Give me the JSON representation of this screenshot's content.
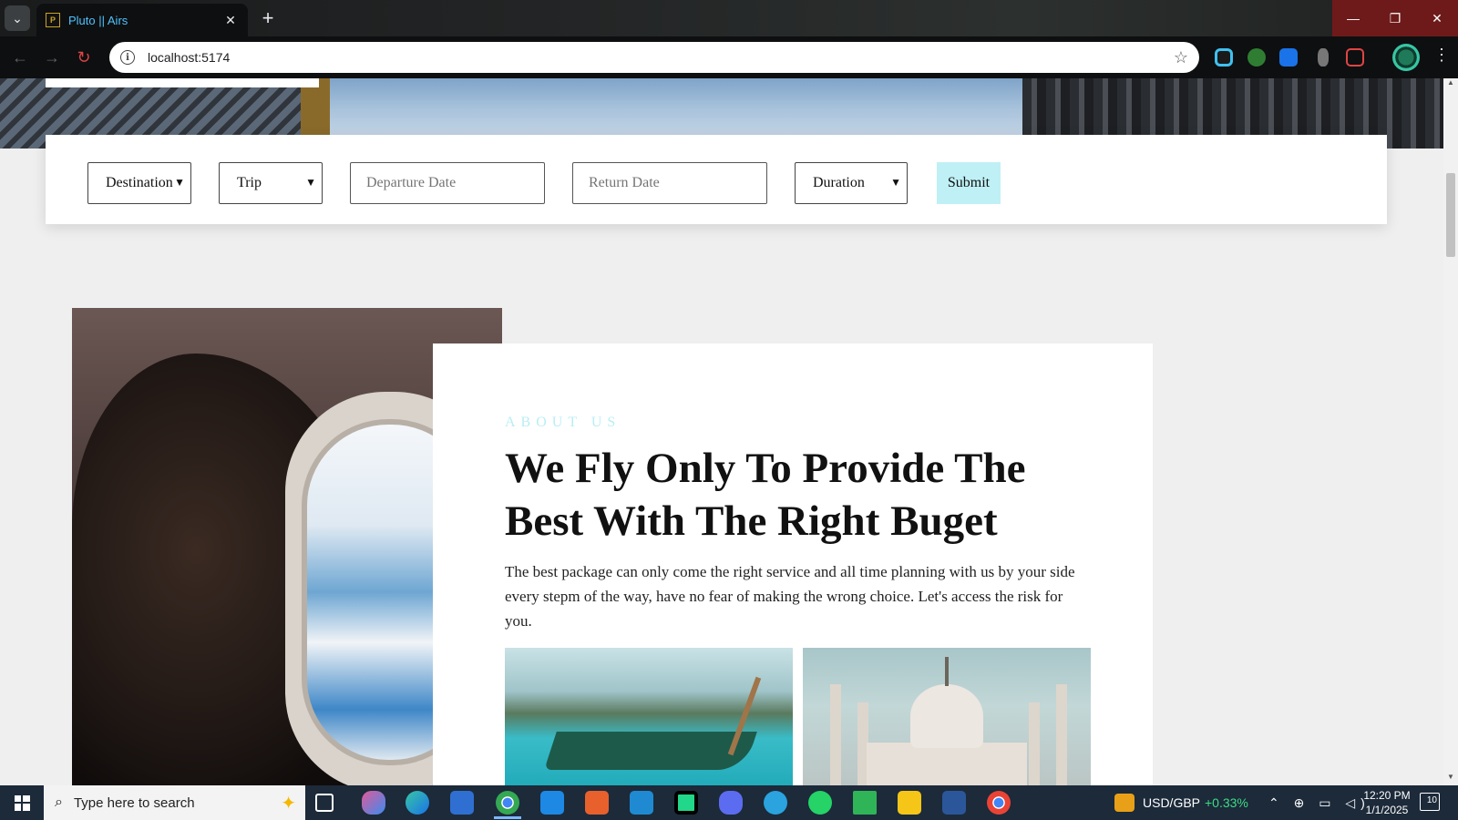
{
  "browser": {
    "tab_title": "Pluto || Airs",
    "favicon_text": "PLUTO",
    "url": "localhost:5174",
    "window_controls": {
      "minimize": "—",
      "maximize": "❐",
      "close": "✕"
    },
    "icons": [
      "tab-search-icon",
      "close-icon",
      "new-tab-icon",
      "back-icon",
      "forward-icon",
      "reload-icon",
      "site-info-icon",
      "bookmark-star-icon",
      "extensions-icon",
      "profile-avatar",
      "menu-icon"
    ]
  },
  "search_form": {
    "destination_label": "Destination",
    "trip_label": "Trip",
    "departure_placeholder": "Departure Date",
    "return_placeholder": "Return Date",
    "duration_label": "Duration",
    "submit_label": "Submit"
  },
  "about": {
    "eyebrow": "ABOUT US",
    "title": "We Fly Only To Provide The Best With The Right Buget",
    "text": "The best package can only come the right service and all time planning with us by your side every stepm of the way, have no fear of making the wrong choice. Let's access the risk for you."
  },
  "taskbar": {
    "search_placeholder": "Type here to search",
    "usd_label": "USD/GBP",
    "usd_delta": "+0.33%",
    "time": "12:20 PM",
    "date": "1/1/2025",
    "notification_count": "10"
  },
  "colors": {
    "accent_cyan": "#bff0f5",
    "eyebrow": "#b9eef3",
    "tab_title": "#4fc3ff",
    "page_bg": "#efefef"
  }
}
